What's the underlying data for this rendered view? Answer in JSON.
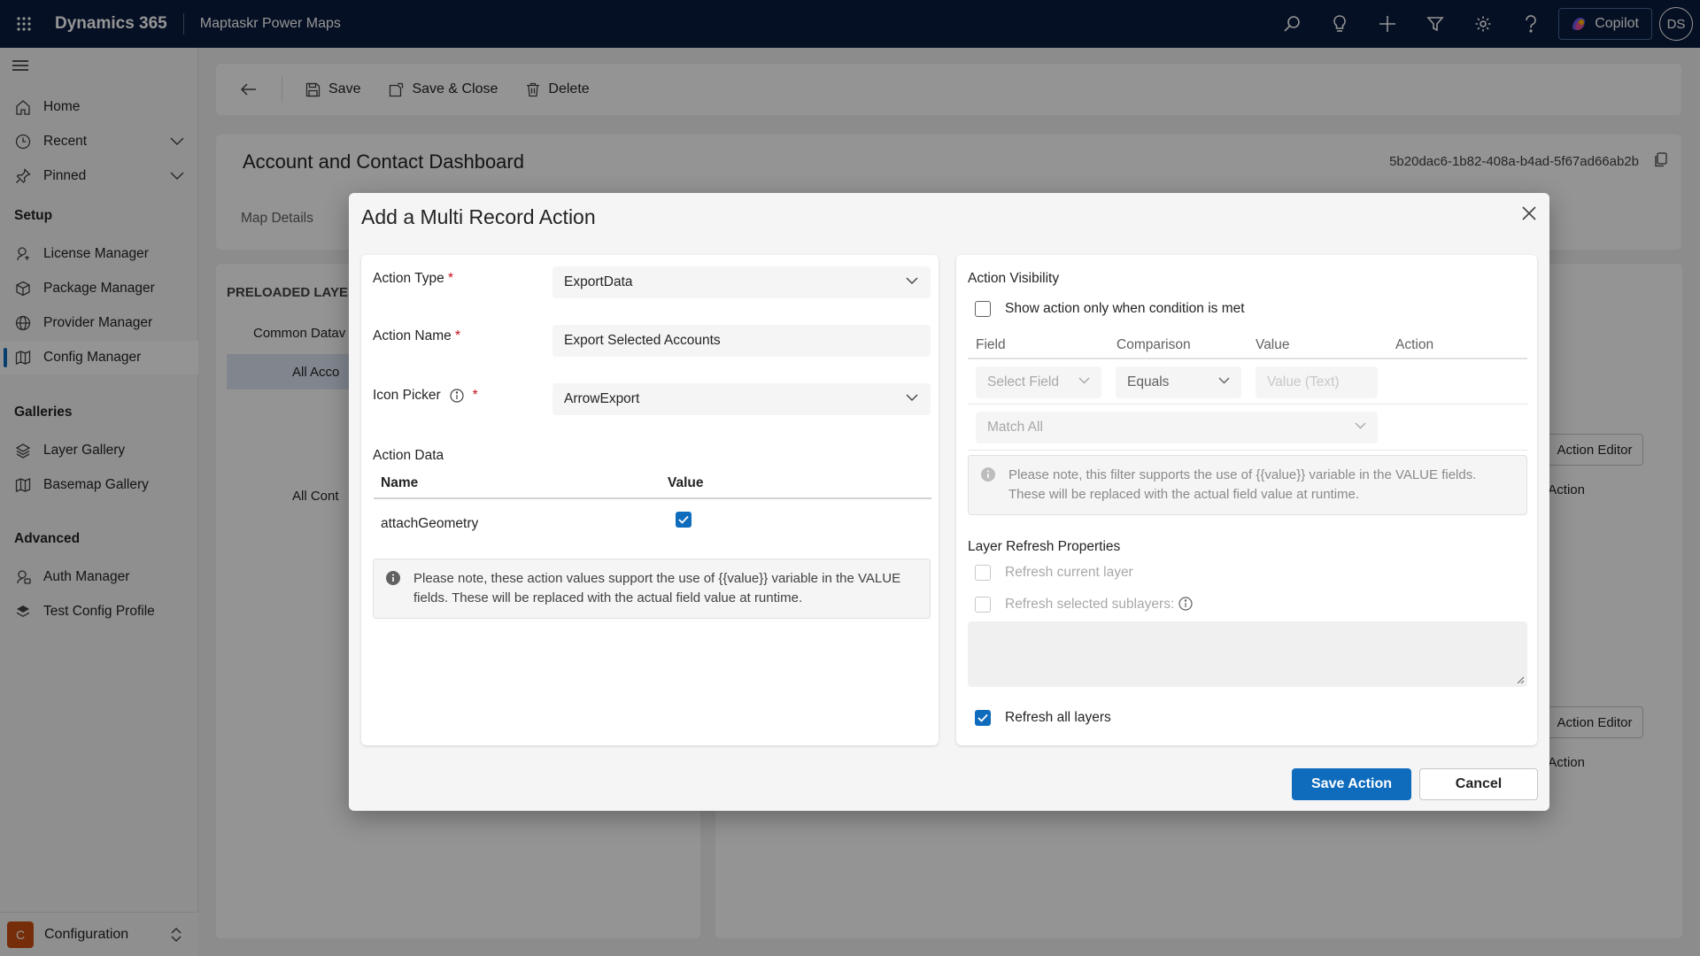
{
  "topbar": {
    "brand": "Dynamics 365",
    "app_name": "Maptaskr Power Maps",
    "copilot_label": "Copilot",
    "avatar_initials": "DS",
    "color": "#0b1d3f"
  },
  "sidebar": {
    "items_top": [
      {
        "label": "Home",
        "icon": "home-icon"
      },
      {
        "label": "Recent",
        "icon": "clock-icon"
      },
      {
        "label": "Pinned",
        "icon": "pin-icon"
      }
    ],
    "setup_heading": "Setup",
    "setup_items": [
      {
        "label": "License Manager",
        "icon": "license-icon"
      },
      {
        "label": "Package Manager",
        "icon": "package-icon"
      },
      {
        "label": "Provider Manager",
        "icon": "globe-icon"
      },
      {
        "label": "Config Manager",
        "icon": "map-icon"
      }
    ],
    "galleries_heading": "Galleries",
    "galleries_items": [
      {
        "label": "Layer Gallery",
        "icon": "layers-icon"
      },
      {
        "label": "Basemap Gallery",
        "icon": "map-icon"
      }
    ],
    "advanced_heading": "Advanced",
    "advanced_items": [
      {
        "label": "Auth Manager",
        "icon": "key-icon"
      },
      {
        "label": "Test Config Profile",
        "icon": "layers-icon"
      }
    ],
    "area": {
      "initial": "C",
      "label": "Configuration"
    }
  },
  "commandbar": {
    "save": "Save",
    "save_close": "Save & Close",
    "delete": "Delete"
  },
  "form": {
    "title": "Account and Contact Dashboard",
    "record_id": "5b20dac6-1b82-408a-b4ad-5f67ad66ab2b",
    "tab_map_details": "Map Details"
  },
  "dialog": {
    "title": "Add a Multi Record Action",
    "action_type_label": "Action Type",
    "action_type_value": "ExportData",
    "action_name_label": "Action Name",
    "action_name_value": "Export Selected Accounts",
    "icon_picker_label": "Icon Picker",
    "icon_picker_value": "ArrowExport",
    "action_data_label": "Action Data",
    "table_headers": {
      "name": "Name",
      "value": "Value"
    },
    "table_rows": [
      {
        "name": "attachGeometry",
        "checked": true
      }
    ],
    "action_note": "Please note, these action values support the use of {{value}} variable in the VALUE fields. These will be replaced with the actual field value at runtime.",
    "visibility_label": "Action Visibility",
    "show_condition_label": "Show action only when condition is met",
    "condition_headers": {
      "field": "Field",
      "comparison": "Comparison",
      "value": "Value",
      "action": "Action"
    },
    "select_field_placeholder": "Select Field",
    "comparison_value": "Equals",
    "value_placeholder": "Value (Text)",
    "match_value": "Match All",
    "filter_note": "Please note, this filter supports the use of {{value}} variable in the VALUE fields. These will be replaced with the actual field value at runtime.",
    "refresh_heading": "Layer Refresh Properties",
    "refresh_current": "Refresh current layer",
    "refresh_sublayers": "Refresh selected sublayers:",
    "refresh_all": "Refresh all layers",
    "save_button": "Save Action",
    "cancel_button": "Cancel"
  },
  "background": {
    "preloaded_layers": "PRELOADED LAYERS",
    "tree": [
      "Common Datav",
      "All Acco",
      "All Cont"
    ],
    "action_editor": "Action Editor",
    "action_col": "Action"
  }
}
